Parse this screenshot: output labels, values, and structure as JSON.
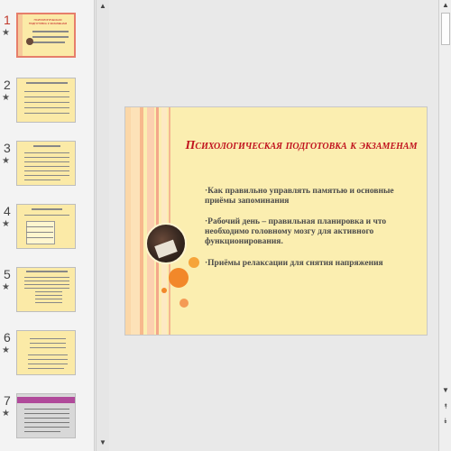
{
  "thumbnails": [
    {
      "number": "1",
      "star": "★",
      "active": true
    },
    {
      "number": "2",
      "star": "★",
      "active": false
    },
    {
      "number": "3",
      "star": "★",
      "active": false
    },
    {
      "number": "4",
      "star": "★",
      "active": false
    },
    {
      "number": "5",
      "star": "★",
      "active": false
    },
    {
      "number": "6",
      "star": "★",
      "active": false
    },
    {
      "number": "7",
      "star": "★",
      "active": false
    }
  ],
  "slide": {
    "title": "Психологическая подготовка к экзаменам",
    "bullets": [
      "·Как правильно управлять памятью и основные приёмы запоминания",
      "·Рабочий день – правильная планировка и что необходимо головному мозгу для активного функционирования.",
      "·Приёмы релаксации для снятия напряжения"
    ]
  },
  "scroll": {
    "up_arrow": "▲",
    "down_arrow": "▼",
    "prev_slide": "⯭",
    "next_slide": "⯯"
  },
  "colors": {
    "slide_bg": "#fbeeb0",
    "title": "#c0121e",
    "accent_orange": "#f28a2a",
    "active_thumb_border": "#e67e6b"
  }
}
